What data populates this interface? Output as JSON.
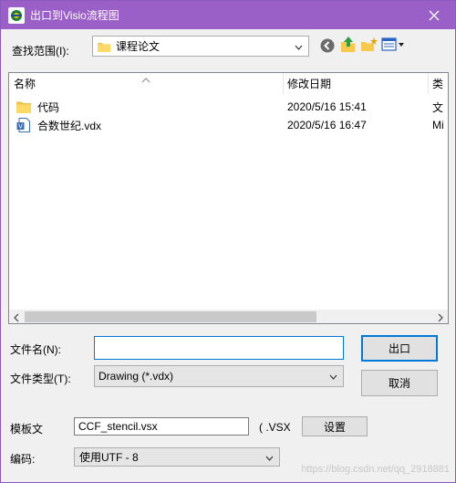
{
  "window": {
    "title": "出口到Visio流程图"
  },
  "lookin": {
    "label": "查找范围(I):",
    "value": "课程论文"
  },
  "list": {
    "columns": [
      "名称",
      "修改日期",
      "类"
    ],
    "rows": [
      {
        "name": "代码",
        "date": "2020/5/16 15:41",
        "type": "文",
        "icon": "folder-icon"
      },
      {
        "name": "合数世纪.vdx",
        "date": "2020/5/16 16:47",
        "type": "Mi",
        "icon": "visio-file-icon"
      }
    ]
  },
  "filename": {
    "label": "文件名(N):",
    "value": ""
  },
  "filetype": {
    "label": "文件类型(T):",
    "value": "Drawing (*.vdx)"
  },
  "buttons": {
    "export": "出口",
    "cancel": "取消",
    "settings": "设置"
  },
  "template": {
    "label": "模板文",
    "value": "CCF_stencil.vsx",
    "ext": "( .VSX"
  },
  "encoding": {
    "label": "编码:",
    "value": "使用UTF - 8"
  },
  "watermark": "https://blog.csdn.net/qq_2918881"
}
